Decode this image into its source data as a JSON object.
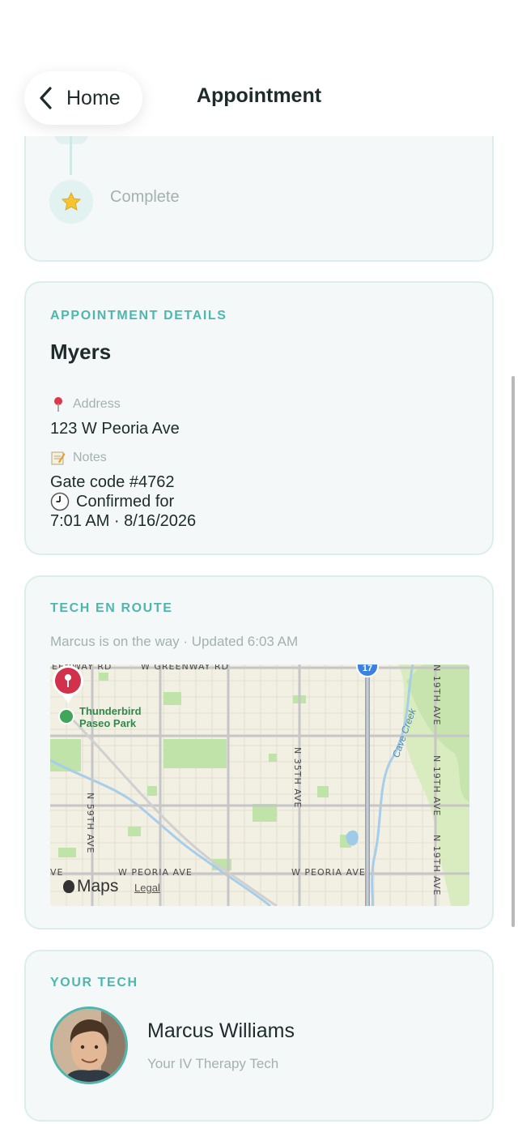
{
  "nav": {
    "back_label": "Home",
    "title": "Appointment"
  },
  "timeline": {
    "final_step_label": "Complete",
    "final_step_icon": "star-icon"
  },
  "details": {
    "section_label": "APPOINTMENT DETAILS",
    "client_name": "Myers",
    "address_label": "Address",
    "address_icon": "pushpin-icon",
    "address_value": "123 W Peoria Ave",
    "notes_label": "Notes",
    "notes_icon": "memo-icon",
    "notes_line1": "Gate code #4762",
    "notes_line2": "Confirmed for",
    "notes_line3": "7:01 AM · 8/16/2026",
    "notes_line2_icon": "clock-icon"
  },
  "route": {
    "section_label": "TECH EN ROUTE",
    "status_text": "Marcus is on the way · Updated 6:03 AM",
    "map": {
      "park_name_line1": "Thunderbird",
      "park_name_line2": "Paseo Park",
      "street_top_left": "EENWAY RD",
      "street_top_mid": "W GREENWAY RD",
      "street_59th": "N 59TH AVE",
      "street_35th": "N 35TH AVE",
      "street_19th": "N 19TH AVE",
      "street_19th_b": "N 19TH AVE",
      "street_19th_c": "N 19TH AVE",
      "street_peoria_left": "W PEORIA AVE",
      "street_peoria_right": "W PEORIA AVE",
      "street_edge": "VE",
      "creek": "Cave Creek",
      "highway": "17",
      "maps_brand": "Maps",
      "legal": "Legal"
    }
  },
  "tech": {
    "section_label": "YOUR TECH",
    "name": "Marcus Williams",
    "role": "Your IV Therapy Tech"
  },
  "colors": {
    "accent": "#4fb6ad",
    "card_bg": "#f4f8f8",
    "card_border": "#dbeeeb",
    "pin": "#d2314b"
  }
}
